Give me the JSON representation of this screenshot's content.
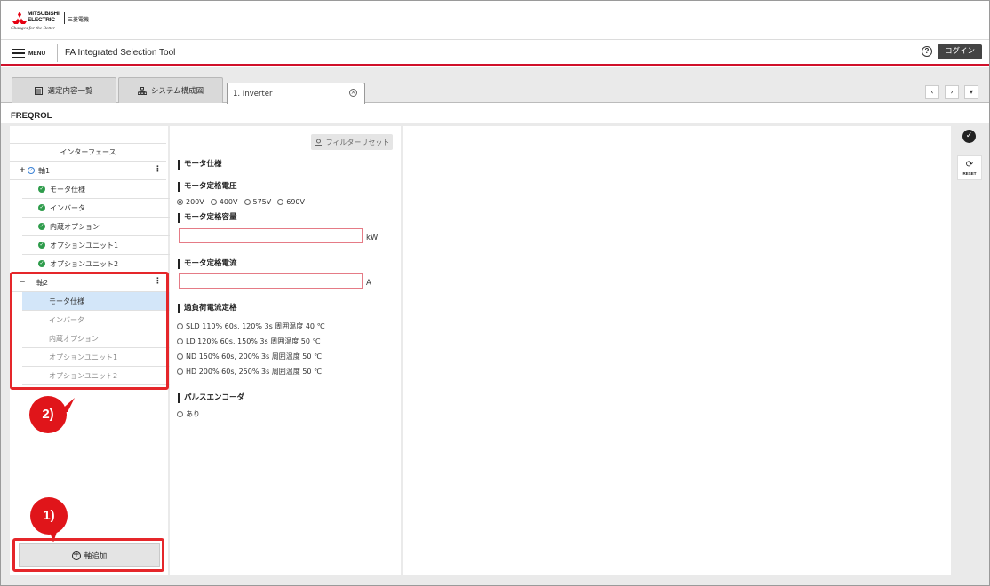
{
  "logo": {
    "brand_line1": "MITSUBISHI",
    "brand_line2": "ELECTRIC",
    "jp": "三菱電機",
    "tagline": "Changes for the Better"
  },
  "header": {
    "menu_label": "MENU",
    "app_title": "FA Integrated Selection Tool",
    "help_symbol": "?",
    "login_label": "ログイン"
  },
  "tabs": [
    {
      "label": "選定内容一覧",
      "icon": "list-icon"
    },
    {
      "label": "システム構成図",
      "icon": "diagram-icon"
    },
    {
      "label": "1. Inverter",
      "active": true
    }
  ],
  "nav": {
    "prev": "‹",
    "next": "›",
    "menu": "▾"
  },
  "section_title": "FREQROL",
  "tree": {
    "interface": "インターフェース",
    "axis1": {
      "label": "軸1",
      "toggle": "+",
      "items": [
        "モータ仕様",
        "インバータ",
        "内蔵オプション",
        "オプションユニット1",
        "オプションユニット2"
      ]
    },
    "axis2": {
      "label": "軸2",
      "toggle": "−",
      "items": [
        "モータ仕様",
        "インバータ",
        "内蔵オプション",
        "オプションユニット1",
        "オプションユニット2"
      ]
    }
  },
  "add_axis_label": "軸追加",
  "badges": {
    "one": "1)",
    "two": "2)"
  },
  "form": {
    "filter_reset": "フィルターリセット",
    "section_heading": "モータ仕様",
    "voltage_label": "モータ定格電圧",
    "voltage_options": [
      "200V",
      "400V",
      "575V",
      "690V"
    ],
    "voltage_selected": "200V",
    "capacity_label": "モータ定格容量",
    "capacity_unit": "kW",
    "current_label": "モータ定格電流",
    "current_unit": "A",
    "overload_label": "過負荷電流定格",
    "overload_options": [
      "SLD 110% 60s, 120% 3s 周囲温度 40 ℃",
      "LD 120% 60s, 150% 3s 周囲温度 50 ℃",
      "ND 150% 60s, 200% 3s 周囲温度 50 ℃",
      "HD 200% 60s, 250% 3s 周囲温度 50 ℃"
    ],
    "encoder_label": "パルスエンコーダ",
    "encoder_option": "あり"
  },
  "side": {
    "reset_label": "RESET"
  },
  "colors": {
    "accent_red": "#d0102a",
    "highlight_red": "#e5262a",
    "selected_row": "#d3e6f9",
    "check_green": "#2e9c4b"
  }
}
